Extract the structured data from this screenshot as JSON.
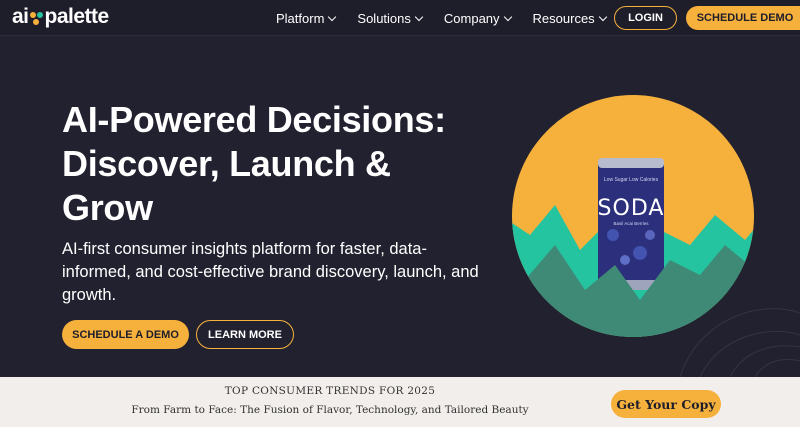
{
  "brand": {
    "logo_left": "ai",
    "logo_right": "palette",
    "dot_colors": [
      "#f6b13d",
      "#25c4a0",
      "#f6b13d"
    ]
  },
  "nav": {
    "items": [
      {
        "label": "Platform",
        "icon": "chevron-down-icon"
      },
      {
        "label": "Solutions",
        "icon": "chevron-down-icon"
      },
      {
        "label": "Company",
        "icon": "chevron-down-icon"
      },
      {
        "label": "Resources",
        "icon": "chevron-down-icon"
      }
    ],
    "login_label": "LOGIN",
    "demo_label": "SCHEDULE DEMO"
  },
  "hero": {
    "title": "AI-Powered Decisions: Discover, Launch & Grow",
    "subtitle": "AI-first consumer insights platform for faster, data-informed, and cost-effective brand discovery, launch, and growth.",
    "primary_cta": "SCHEDULE A DEMO",
    "secondary_cta": "LEARN MORE",
    "product": {
      "can_top_text": "Low Sugar Low Calories",
      "can_brand": "SODA",
      "can_flavor": "Basil Acai Berries"
    }
  },
  "banner": {
    "title": "TOP CONSUMER TRENDS FOR 2025",
    "subtitle": "From Farm to Face: The Fusion of Flavor, Technology, and Tailored Beauty",
    "cta": "Get Your Copy"
  },
  "colors": {
    "accent": "#f6b13d",
    "background": "#22212f",
    "teal": "#25c4a0",
    "dark_teal": "#3e8a76",
    "banner_bg": "#f1eeeb"
  }
}
